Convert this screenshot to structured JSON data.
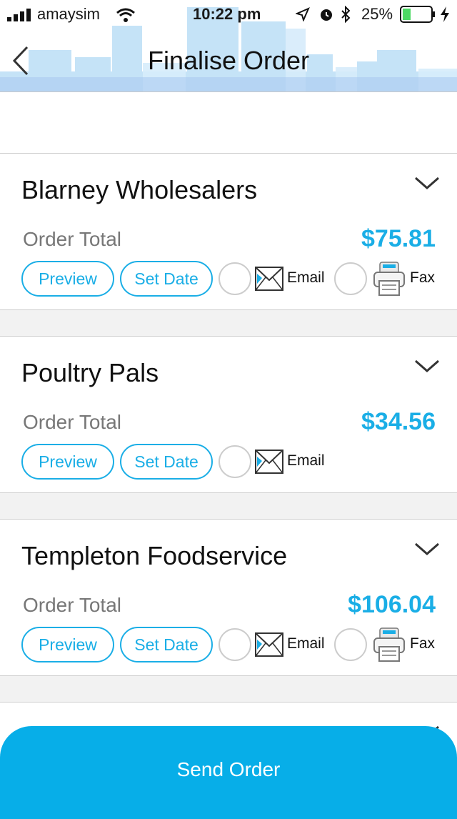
{
  "status_bar": {
    "carrier": "amaysim",
    "time": "10:22 pm",
    "battery": "25%"
  },
  "nav": {
    "title": "Finalise Order"
  },
  "orders": [
    {
      "supplier": "Blarney Wholesalers",
      "total_label": "Order Total",
      "total": "$75.81",
      "preview": "Preview",
      "set_date": "Set Date",
      "email": "Email",
      "fax": "Fax"
    },
    {
      "supplier": "Poultry Pals",
      "total_label": "Order Total",
      "total": "$34.56",
      "preview": "Preview",
      "set_date": "Set Date",
      "email": "Email"
    },
    {
      "supplier": "Templeton Foodservice",
      "total_label": "Order Total",
      "total": "$106.04",
      "preview": "Preview",
      "set_date": "Set Date",
      "email": "Email",
      "fax": "Fax"
    }
  ],
  "send_button": "Send Order",
  "colors": {
    "accent": "#1aaee6",
    "send_bg": "#07aee8"
  }
}
